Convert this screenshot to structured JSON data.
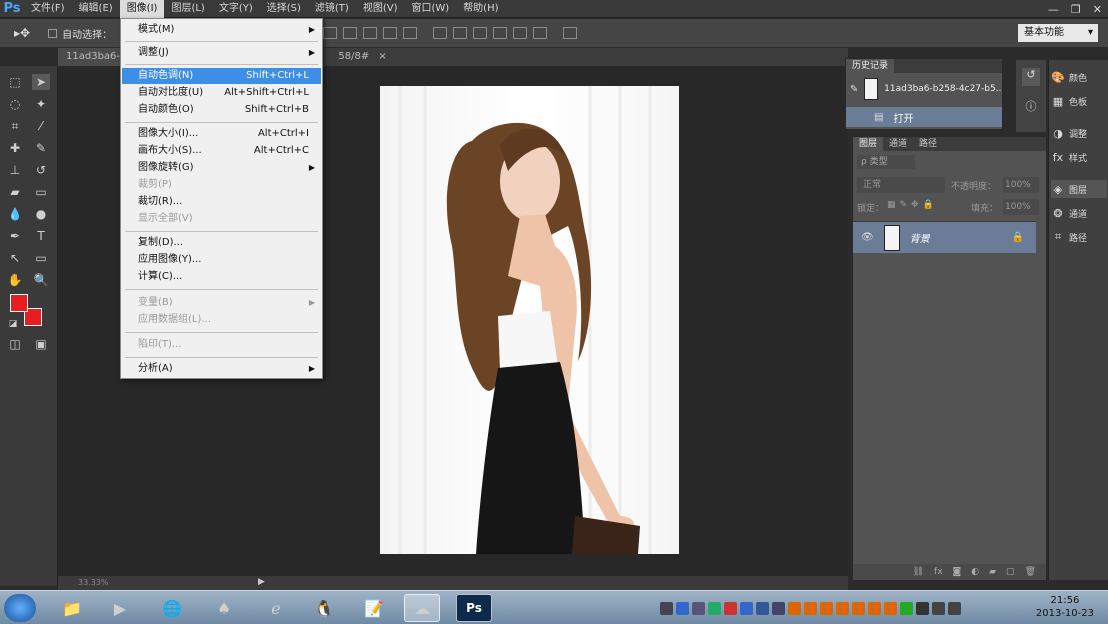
{
  "app": {
    "logo": "Ps"
  },
  "menubar": {
    "items": [
      "文件(F)",
      "编辑(E)",
      "图像(I)",
      "图层(L)",
      "文字(Y)",
      "选择(S)",
      "滤镜(T)",
      "视图(V)",
      "窗口(W)",
      "帮助(H)"
    ]
  },
  "options_bar": {
    "auto_select_label": "自动选择：",
    "workspace": "基本功能"
  },
  "doc_tabs": [
    "11ad3ba6-b",
    "58/8#"
  ],
  "image_menu": {
    "items": [
      {
        "label": "模式(M)",
        "shortcut": "",
        "submenu": true,
        "disabled": false,
        "highlight": false
      },
      {
        "label": "调整(J)",
        "shortcut": "",
        "submenu": true,
        "disabled": false,
        "highlight": false
      },
      {
        "label": "自动色调(N)",
        "shortcut": "Shift+Ctrl+L",
        "submenu": false,
        "disabled": false,
        "highlight": true
      },
      {
        "label": "自动对比度(U)",
        "shortcut": "Alt+Shift+Ctrl+L",
        "submenu": false,
        "disabled": false,
        "highlight": false
      },
      {
        "label": "自动颜色(O)",
        "shortcut": "Shift+Ctrl+B",
        "submenu": false,
        "disabled": false,
        "highlight": false
      },
      {
        "label": "图像大小(I)...",
        "shortcut": "Alt+Ctrl+I",
        "submenu": false,
        "disabled": false,
        "highlight": false
      },
      {
        "label": "画布大小(S)...",
        "shortcut": "Alt+Ctrl+C",
        "submenu": false,
        "disabled": false,
        "highlight": false
      },
      {
        "label": "图像旋转(G)",
        "shortcut": "",
        "submenu": true,
        "disabled": false,
        "highlight": false
      },
      {
        "label": "裁剪(P)",
        "shortcut": "",
        "submenu": false,
        "disabled": true,
        "highlight": false
      },
      {
        "label": "裁切(R)...",
        "shortcut": "",
        "submenu": false,
        "disabled": false,
        "highlight": false
      },
      {
        "label": "显示全部(V)",
        "shortcut": "",
        "submenu": false,
        "disabled": true,
        "highlight": false
      },
      {
        "label": "复制(D)...",
        "shortcut": "",
        "submenu": false,
        "disabled": false,
        "highlight": false
      },
      {
        "label": "应用图像(Y)...",
        "shortcut": "",
        "submenu": false,
        "disabled": false,
        "highlight": false
      },
      {
        "label": "计算(C)...",
        "shortcut": "",
        "submenu": false,
        "disabled": false,
        "highlight": false
      },
      {
        "label": "变量(B)",
        "shortcut": "",
        "submenu": true,
        "disabled": true,
        "highlight": false
      },
      {
        "label": "应用数据组(L)...",
        "shortcut": "",
        "submenu": false,
        "disabled": true,
        "highlight": false
      },
      {
        "label": "陷印(T)...",
        "shortcut": "",
        "submenu": false,
        "disabled": true,
        "highlight": false
      },
      {
        "label": "分析(A)",
        "shortcut": "",
        "submenu": true,
        "disabled": false,
        "highlight": false
      }
    ]
  },
  "history_panel": {
    "tab": "历史记录",
    "snapshot_name": "11ad3ba6-b258-4c27-b5...",
    "step_label": "打开"
  },
  "layers_panel": {
    "tabs": [
      "图层",
      "通道",
      "路径"
    ],
    "kind_filter": "ρ 类型",
    "blend_mode": "正常",
    "opacity_label": "不透明度：",
    "opacity_value": "100%",
    "lock_label": "锁定：",
    "fill_label": "填充：",
    "fill_value": "100%",
    "layer_name": "背景"
  },
  "right_dock": {
    "items": [
      "颜色",
      "色板",
      "调整",
      "样式",
      "图层",
      "通道",
      "路径"
    ]
  },
  "status": {
    "zoom": "33.33%"
  },
  "clock": {
    "time": "21:56",
    "date": "2013-10-23"
  },
  "colors": {
    "foreground": "#e61e1e",
    "background": "#e61e1e",
    "menu_highlight": "#3d8ee6"
  }
}
